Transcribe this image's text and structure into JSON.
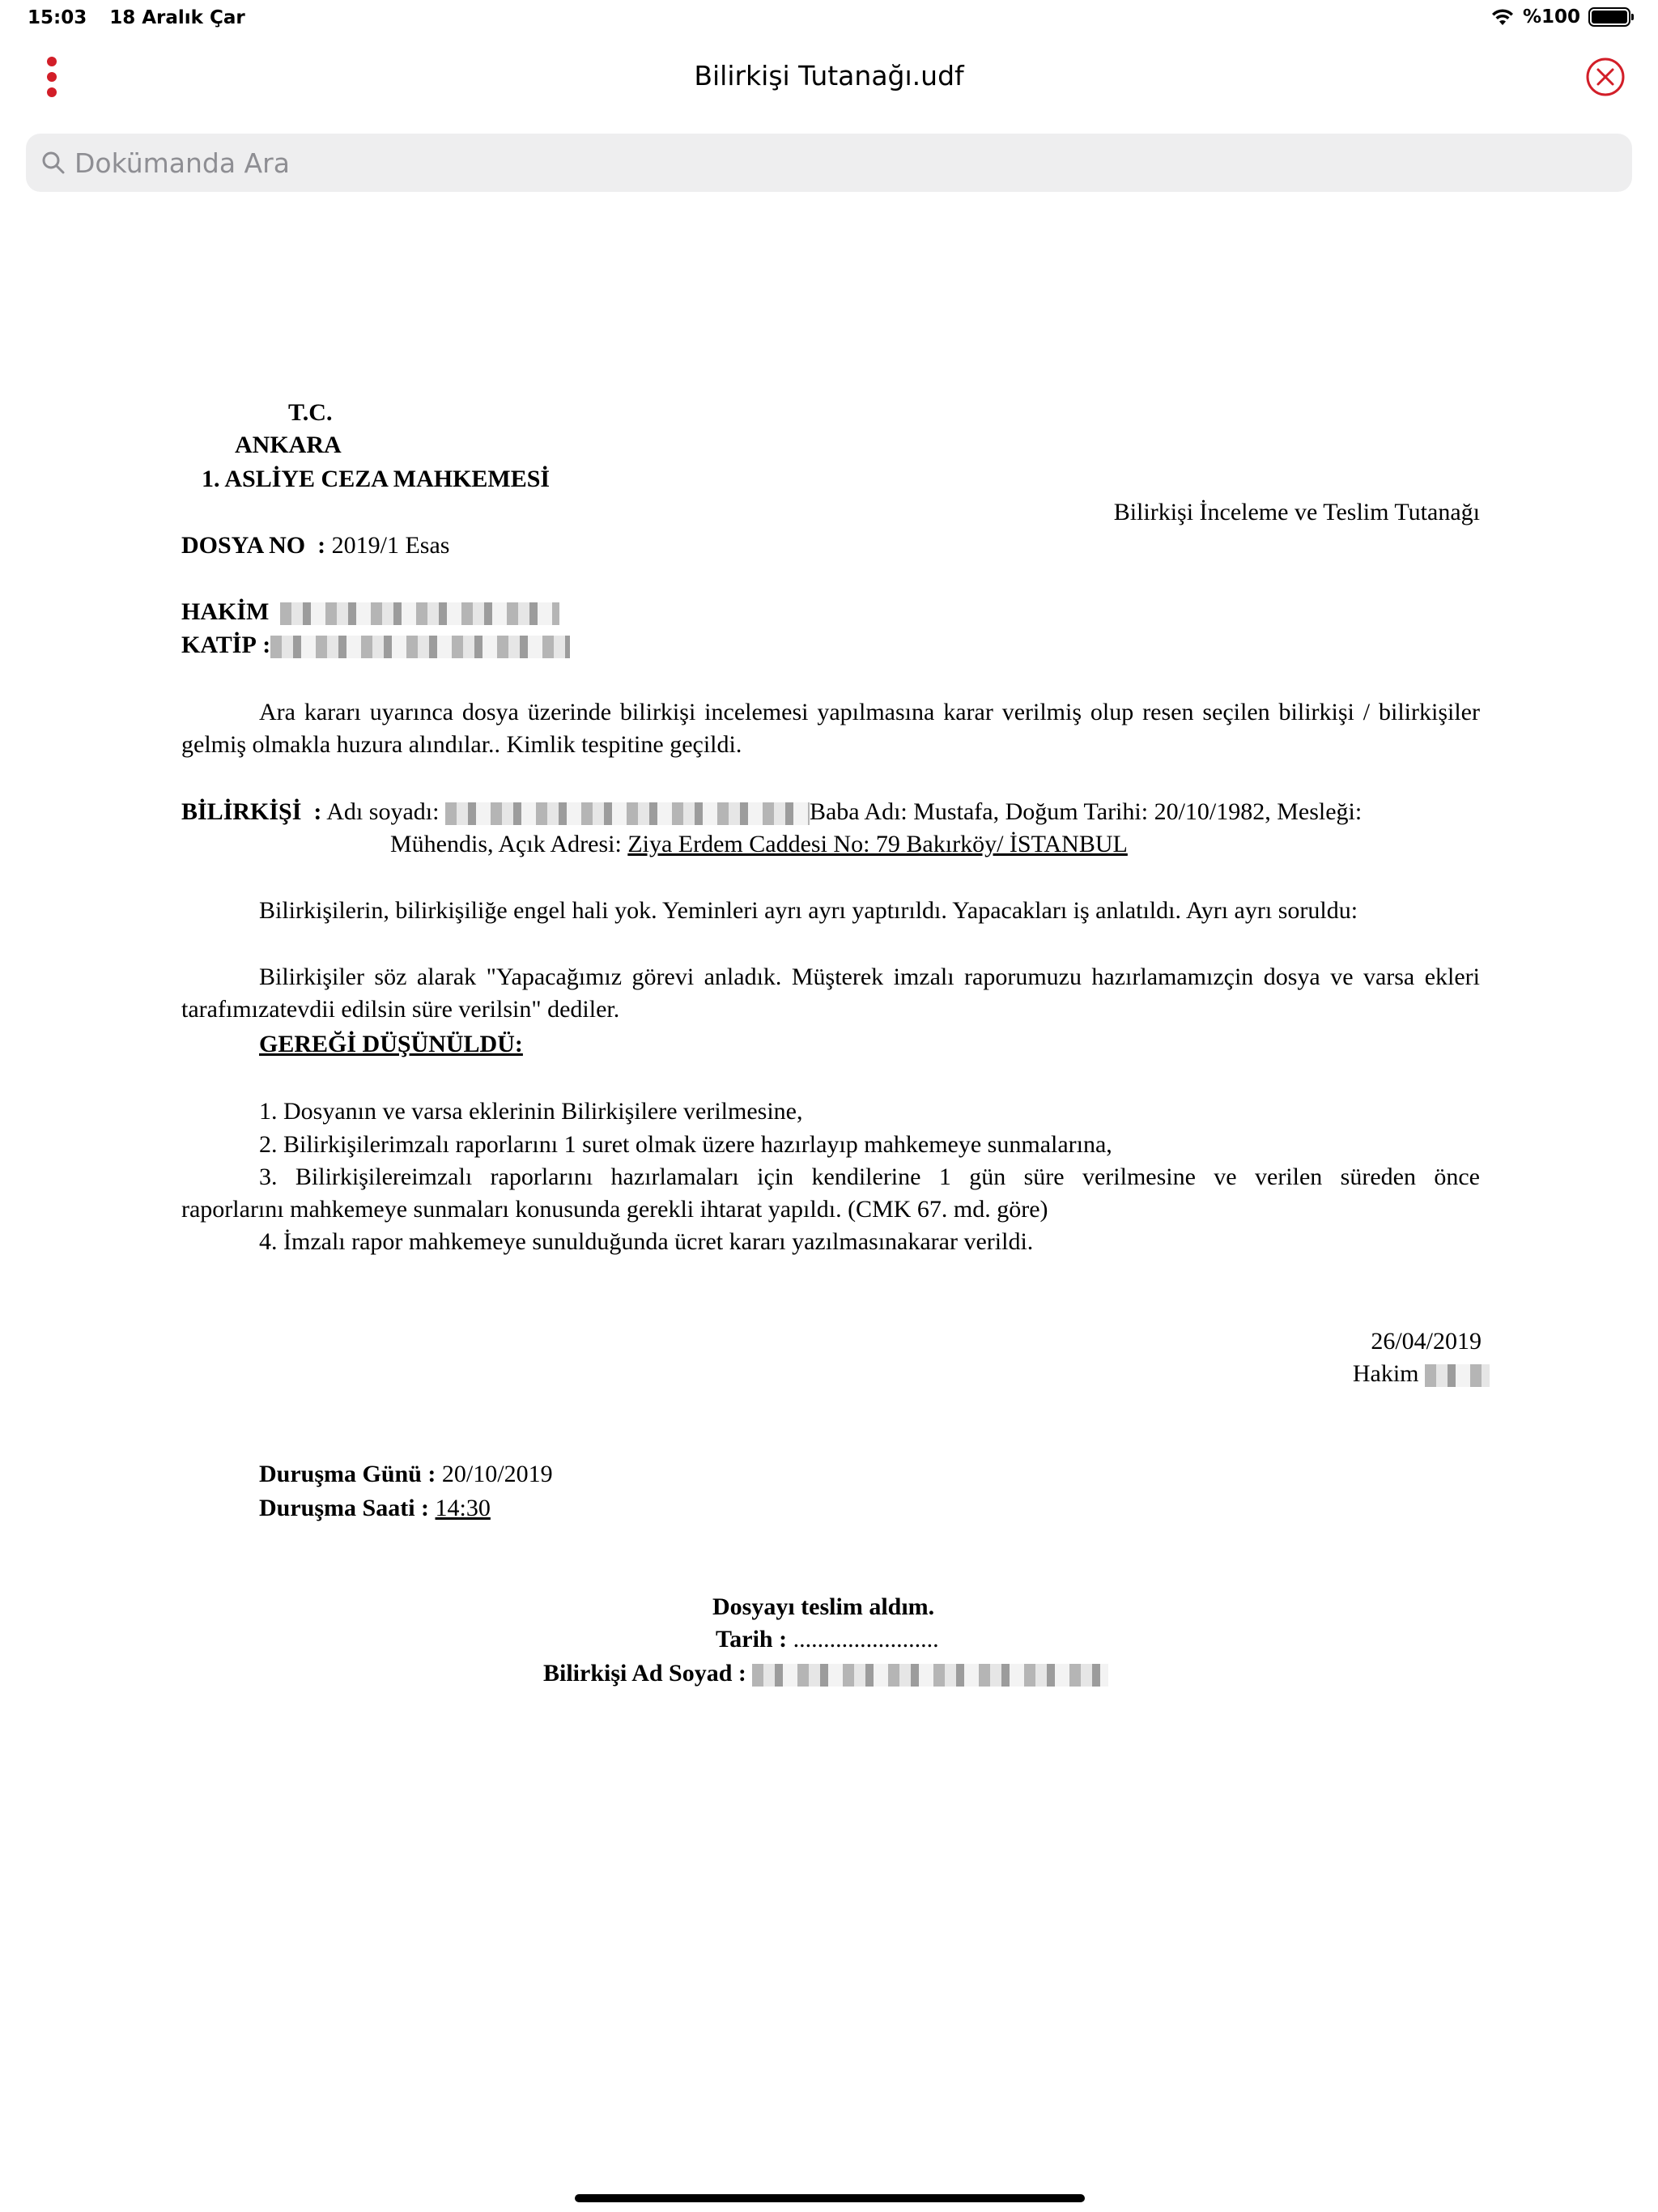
{
  "status": {
    "time": "15:03",
    "date": "18 Aralık Çar",
    "battery": "%100"
  },
  "nav": {
    "title": "Bilirkişi Tutanağı.udf"
  },
  "search": {
    "placeholder": "Dokümanda Ara"
  },
  "document": {
    "header": {
      "line1": "T.C.",
      "line2": "ANKARA",
      "line3": "1. ASLİYE CEZA MAHKEMESİ",
      "doc_title": "Bilirkişi İnceleme ve Teslim Tutanağı"
    },
    "dosya_label": "DOSYA NO",
    "dosya_sep": ":",
    "dosya_value": "2019/1 Esas",
    "hakim_label": "HAKİM",
    "katip_label": "KATİP",
    "katip_sep": ":",
    "intro": "Ara kararı uyarınca dosya üzerinde bilirkişi incelemesi yapılmasına karar verilmiş olup resen seçilen bilirkişi / bilirkişiler gelmiş olmakla huzura alındılar.. Kimlik tespitine geçildi.",
    "bilirkisi": {
      "label": "BİLİRKİŞİ",
      "sep": ":",
      "name_label": "Adı soyadı:",
      "rest1": "Baba Adı: Mustafa, Doğum Tarihi: 20/10/1982, Mesleği:",
      "line2_prefix": "Mühendis, Açık Adresi:",
      "address": "Ziya Erdem Caddesi No: 79 Bakırköy/ İSTANBUL"
    },
    "para1": "Bilirkişilerin, bilirkişiliğe engel hali yok. Yeminleri ayrı ayrı yaptırıldı. Yapacakları iş anlatıldı. Ayrı ayrı soruldu:",
    "para2": "Bilirkişiler söz alarak \"Yapacağımız görevi anladık. Müşterek imzalı raporumuzu hazırlamamızçin dosya ve varsa ekleri tarafımızatevdii edilsin süre verilsin\" dediler.",
    "gerekçe_title": "GEREĞİ DÜŞÜNÜLDÜ:",
    "items": [
      "1. Dosyanın ve varsa eklerinin Bilirkişilere verilmesine,",
      "2. Bilirkişilerimzalı raporlarını 1 suret olmak üzere hazırlayıp mahkemeye sunmalarına,",
      "3. Bilirkişilereimzalı raporlarını hazırlamaları için kendilerine 1 gün süre verilmesine ve verilen süreden önce",
      "raporlarını mahkemeye sunmaları konusunda gerekli ihtarat yapıldı. (CMK 67. md. göre)",
      "4. İmzalı rapor mahkemeye sunulduğunda ücret kararı yazılmasınakarar verildi."
    ],
    "date": "26/04/2019",
    "hakim_sign": "Hakim",
    "durusma_gunu_label": "Duruşma Günü :",
    "durusma_gunu": "20/10/2019",
    "durusma_saati_label": "Duruşma Saati :",
    "durusma_saati": "14:30",
    "teslim": "Dosyayı teslim aldım.",
    "tarih_label": "Tarih :",
    "tarih_dots": "........................",
    "ad_soyad_label": "Bilirkişi Ad Soyad :"
  }
}
